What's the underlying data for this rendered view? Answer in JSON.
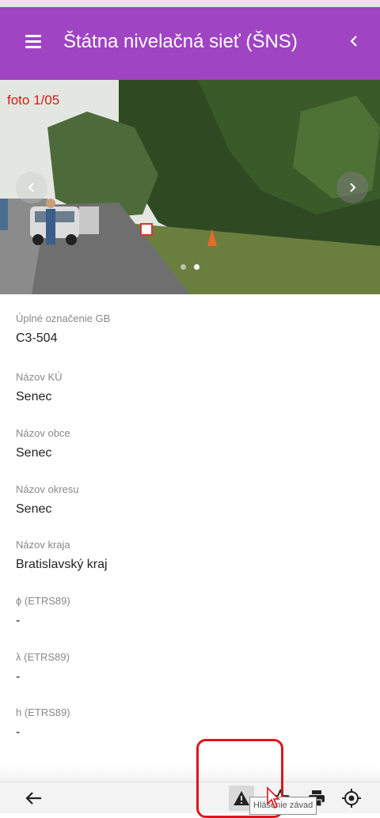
{
  "app_bar": {
    "title": "Štátna nivelačná sieť (ŠNS)"
  },
  "gallery": {
    "counter": "foto 1/05",
    "dots": 2,
    "active_dot": 2
  },
  "fields": [
    {
      "label": "Úplné označenie GB",
      "value": "C3-504"
    },
    {
      "label": "Názov KÚ",
      "value": "Senec"
    },
    {
      "label": "Názov obce",
      "value": "Senec"
    },
    {
      "label": "Názov okresu",
      "value": "Senec"
    },
    {
      "label": "Názov kraja",
      "value": "Bratislavský kraj"
    },
    {
      "label": "ϕ (ETRS89)",
      "value": "-"
    },
    {
      "label": "λ (ETRS89)",
      "value": "-"
    },
    {
      "label": "h (ETRS89)",
      "value": "-"
    }
  ],
  "bottom_bar": {
    "tooltip": "Hlásenie závad",
    "icons": [
      "back-arrow-icon",
      "warning-icon",
      "star-icon",
      "printer-icon",
      "locate-icon"
    ]
  },
  "colors": {
    "primary": "#9f44c3",
    "counter_red": "#e01616",
    "highlight_red": "#e0141c"
  }
}
